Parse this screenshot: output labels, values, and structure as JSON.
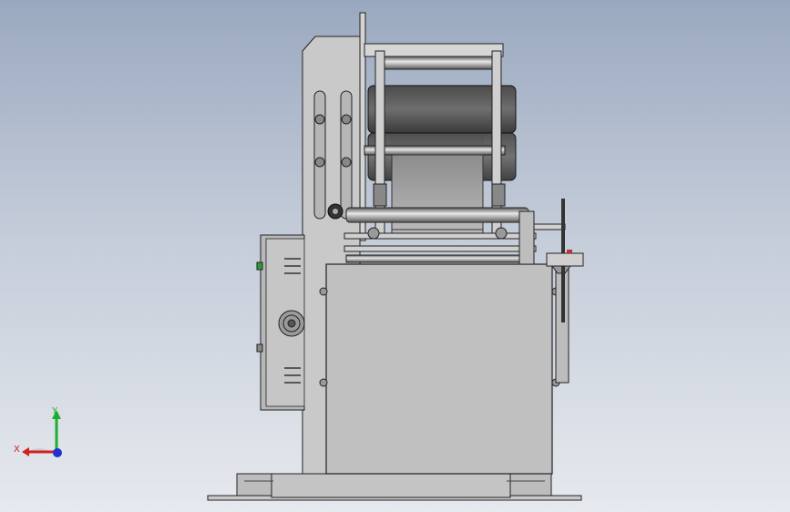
{
  "viewport": {
    "background_top": "#9aa8bf",
    "background_bottom": "#e6e9ee"
  },
  "model": {
    "description_icon": "machine-assembly-icon"
  },
  "triad": {
    "x_label": "X",
    "y_label": "Y",
    "x_color": "#d22020",
    "y_color": "#1eae2e",
    "z_color": "#2030d0"
  }
}
